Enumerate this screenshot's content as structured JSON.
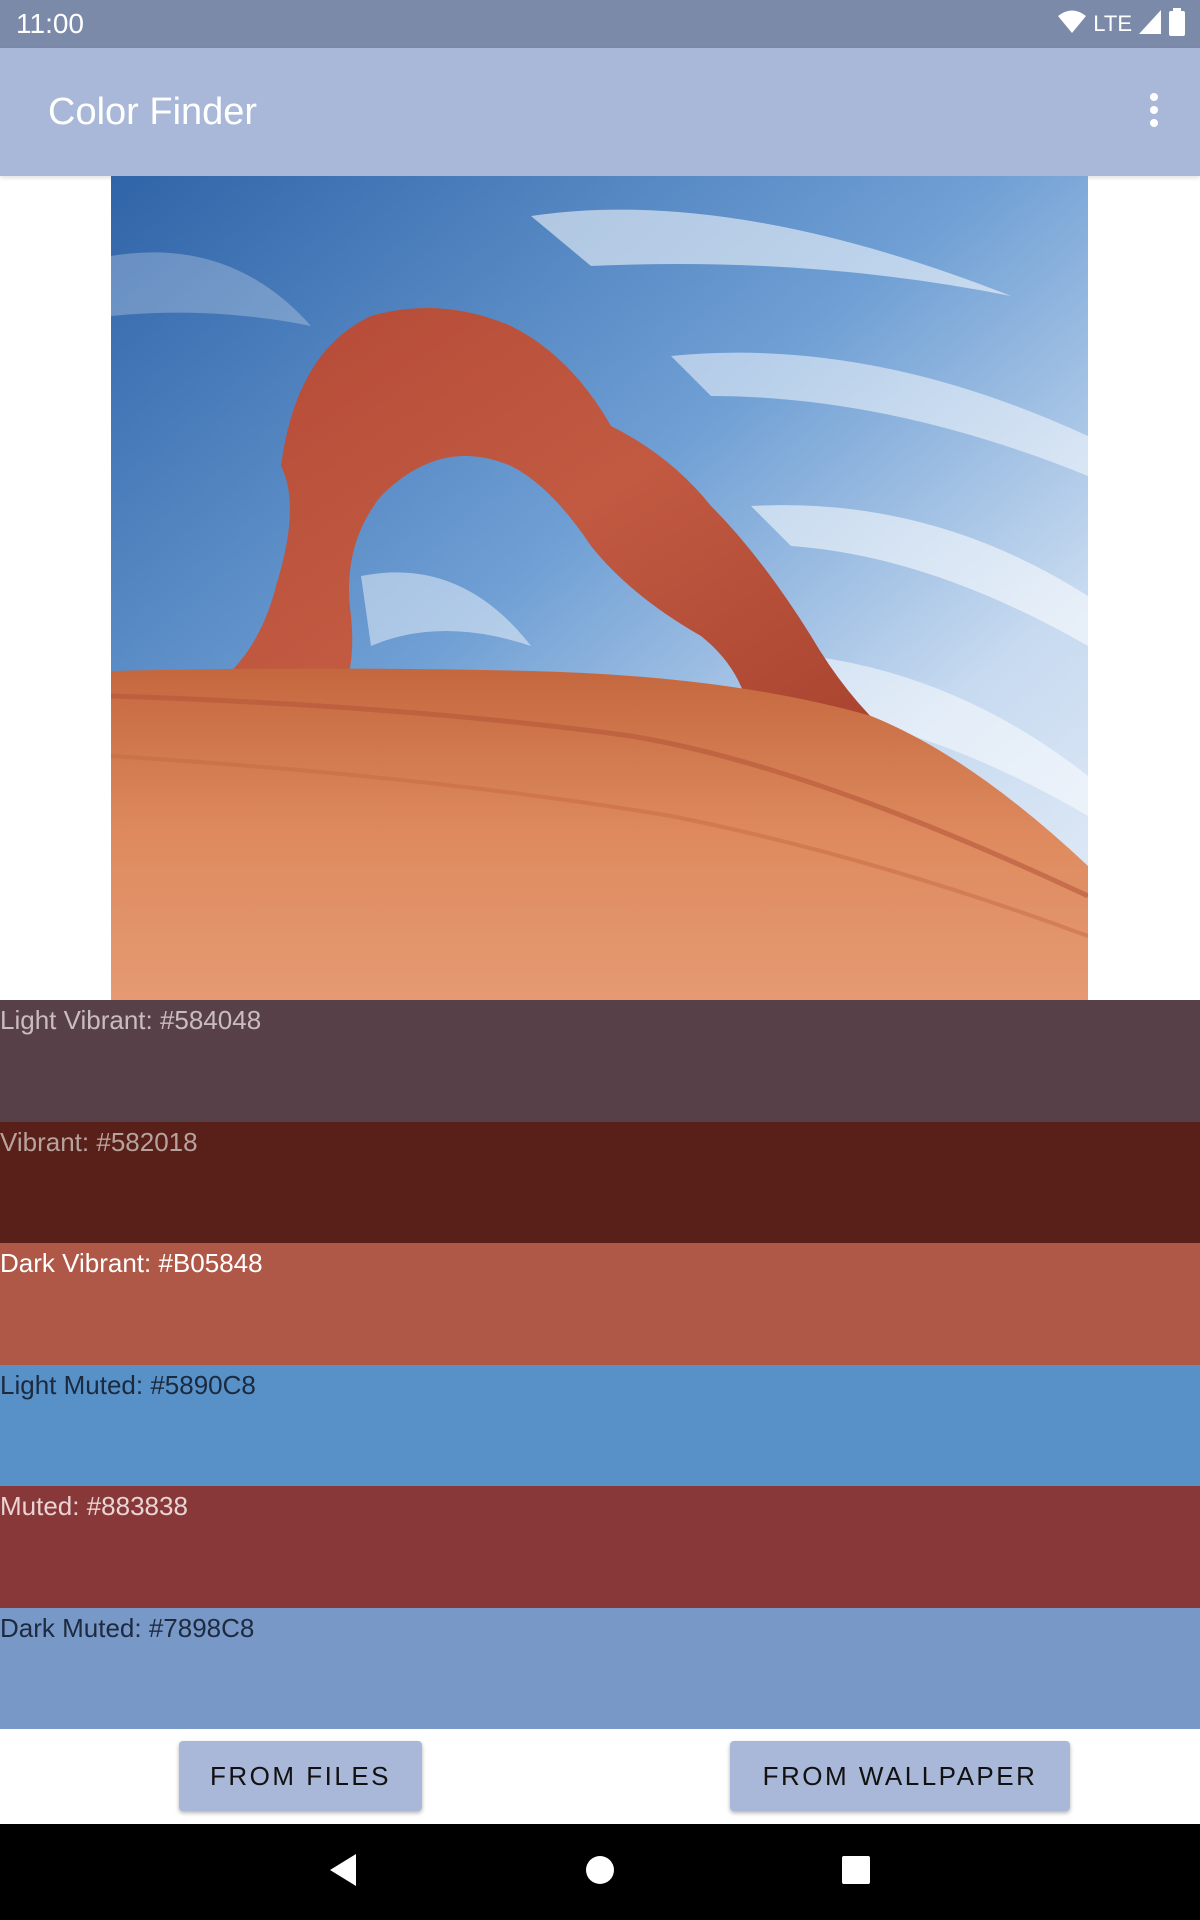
{
  "status_bar": {
    "time": "11:00",
    "network": "LTE",
    "icons": [
      "wifi-icon",
      "cell-signal-icon",
      "battery-icon"
    ]
  },
  "app_bar": {
    "title": "Color Finder",
    "menu_icon": "more-vert-icon"
  },
  "image": {
    "subject": "arch-rock-photo"
  },
  "swatches": [
    {
      "label": "Light Vibrant: #584048",
      "color": "#584048",
      "text_color": "#c9bcc0"
    },
    {
      "label": "Vibrant: #582018",
      "color": "#582018",
      "text_color": "#b8a29e"
    },
    {
      "label": "Dark Vibrant: #B05848",
      "color": "#B05848",
      "text_color": "#ffffff"
    },
    {
      "label": "Light Muted: #5890C8",
      "color": "#5890C8",
      "text_color": "#1b2a3e"
    },
    {
      "label": "Muted: #883838",
      "color": "#883838",
      "text_color": "#e9d3d3"
    },
    {
      "label": "Dark Muted: #7898C8",
      "color": "#7898C8",
      "text_color": "#1e2a3f"
    }
  ],
  "buttons": {
    "from_files": "FROM FILES",
    "from_wallpaper": "FROM WALLPAPER"
  },
  "colors": {
    "status_bar": "#7a8aa8",
    "app_bar": "#a9b8d8",
    "button": "#a9b8d8",
    "nav_bar": "#000000"
  },
  "nav": {
    "icons": [
      "back-icon",
      "home-icon",
      "recents-icon"
    ]
  }
}
